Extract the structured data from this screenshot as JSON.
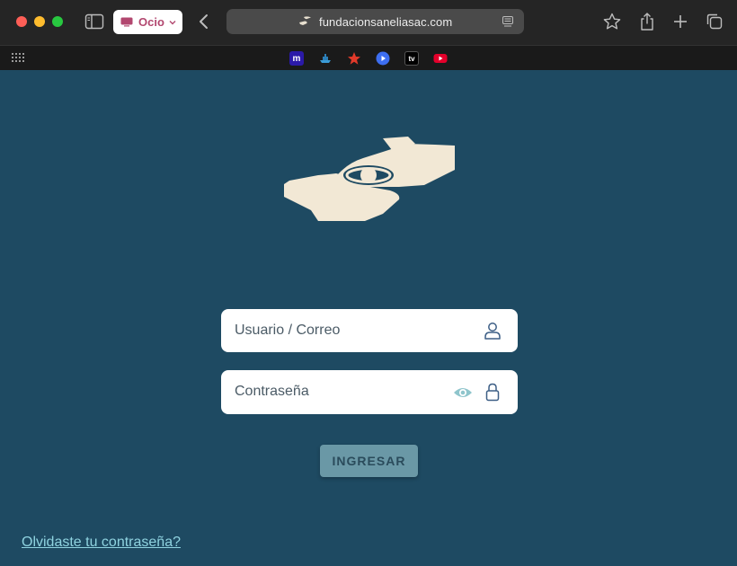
{
  "browser": {
    "tab_group_label": "Ocio",
    "url": "fundacionsaneliasac.com",
    "favorites": [
      {
        "name": "m",
        "color": "#2b1aa8"
      },
      {
        "name": "ship",
        "color": "#1a1a1a"
      },
      {
        "name": "star",
        "color": "#1a1a1a"
      },
      {
        "name": "play",
        "color": "#3d6ef0"
      },
      {
        "name": "tv",
        "color": "#000000"
      },
      {
        "name": "youtube",
        "color": "#e4002b"
      }
    ],
    "favorite_labels": {
      "m": "m",
      "tv": "tv"
    }
  },
  "page": {
    "background": "#1e4a62",
    "logo_color": "#f2e8d5",
    "username_placeholder": "Usuario / Correo",
    "password_placeholder": "Contraseña",
    "login_button": "INGRESAR",
    "forgot_link": "Olvidaste tu contraseña?"
  }
}
